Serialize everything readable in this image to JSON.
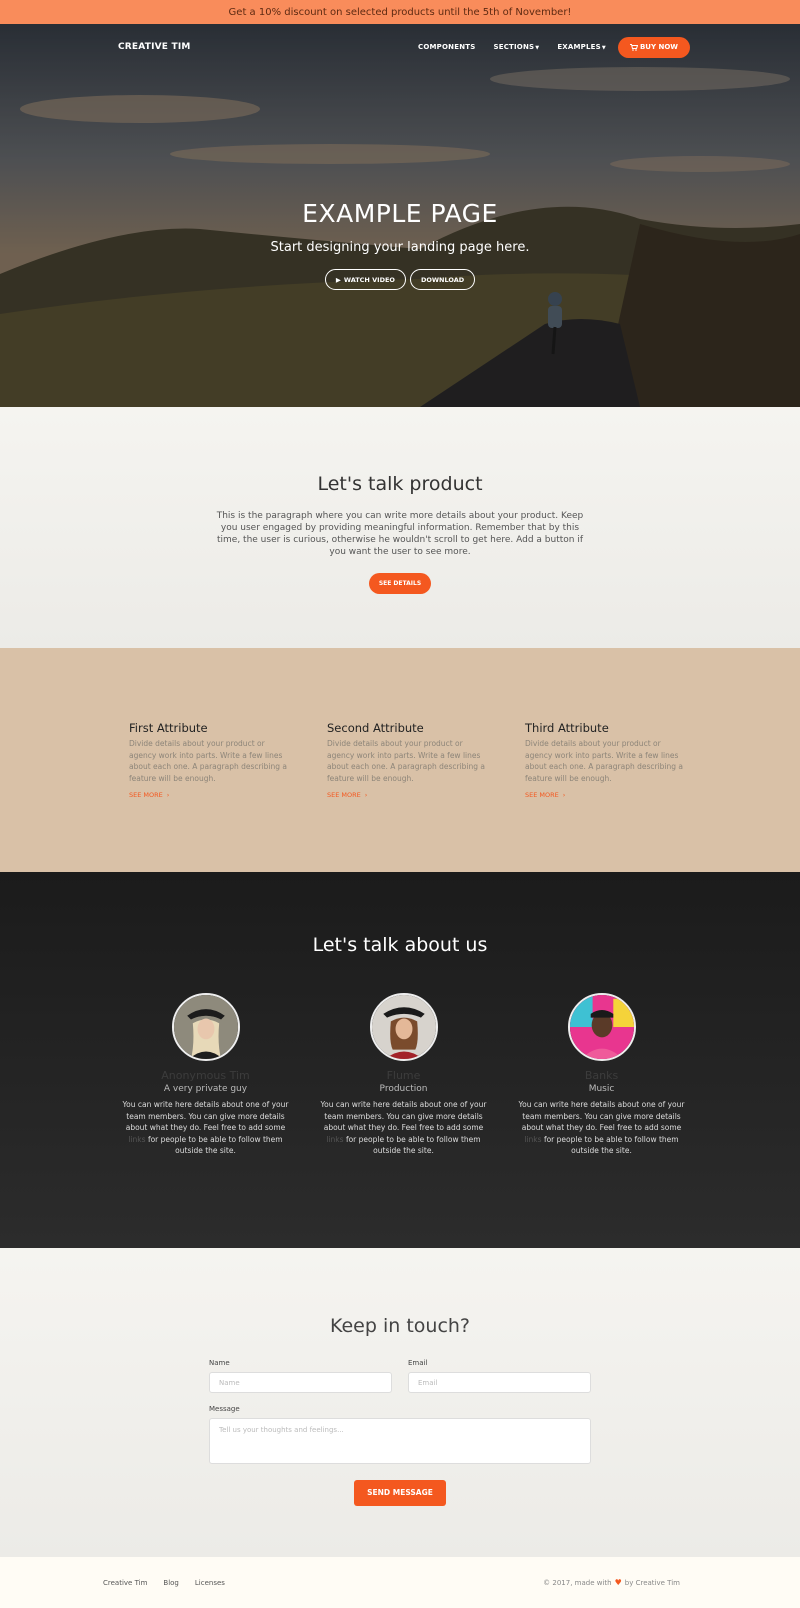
{
  "promo": {
    "text": "Get a 10% discount on selected products until the 5th of November!"
  },
  "nav": {
    "brand": "CREATIVE TIM",
    "links": [
      {
        "label": "COMPONENTS"
      },
      {
        "label": "SECTIONS"
      },
      {
        "label": "EXAMPLES"
      }
    ],
    "buy_label": "BUY NOW"
  },
  "hero": {
    "title": "EXAMPLE PAGE",
    "subtitle": "Start designing your landing page here.",
    "watch_label": "WATCH VIDEO",
    "download_label": "DOWNLOAD"
  },
  "product": {
    "title": "Let's talk product",
    "paragraph": "This is the paragraph where you can write more details about your product. Keep you user engaged by providing meaningful information. Remember that by this time, the user is curious, otherwise he wouldn't scroll to get here. Add a button if you want the user to see more.",
    "button": "SEE DETAILS"
  },
  "attributes": [
    {
      "title": "First Attribute",
      "text": "Divide details about your product or agency work into parts. Write a few lines about each one. A paragraph describing a feature will be enough.",
      "link": "SEE MORE"
    },
    {
      "title": "Second Attribute",
      "text": "Divide details about your product or agency work into parts. Write a few lines about each one. A paragraph describing a feature will be enough.",
      "link": "SEE MORE"
    },
    {
      "title": "Third Attribute",
      "text": "Divide details about your product or agency work into parts. Write a few lines about each one. A paragraph describing a feature will be enough.",
      "link": "SEE MORE"
    }
  ],
  "team": {
    "title": "Let's talk about us",
    "members": [
      {
        "name": "Anonymous Tim",
        "role": "A very private guy",
        "desc_before": "You can write here details about one of your team members. You can give more details about what they do. Feel free to add some",
        "link": "links",
        "desc_after": "for people to be able to follow them outside the site."
      },
      {
        "name": "Flume",
        "role": "Production",
        "desc_before": "You can write here details about one of your team members. You can give more details about what they do. Feel free to add some",
        "link": "links",
        "desc_after": "for people to be able to follow them outside the site."
      },
      {
        "name": "Banks",
        "role": "Music",
        "desc_before": "You can write here details about one of your team members. You can give more details about what they do. Feel free to add some",
        "link": "links",
        "desc_after": "for people to be able to follow them outside the site."
      }
    ]
  },
  "contact": {
    "title": "Keep in touch?",
    "name_label": "Name",
    "name_placeholder": "Name",
    "email_label": "Email",
    "email_placeholder": "Email",
    "message_label": "Message",
    "message_placeholder": "Tell us your thoughts and feelings...",
    "send_label": "SEND MESSAGE"
  },
  "footer": {
    "links": [
      "Creative Tim",
      "Blog",
      "Licenses"
    ],
    "copy_before": "© 2017, made with",
    "copy_after": "by Creative Tim"
  },
  "colors": {
    "accent": "#f4581f",
    "promo_bg": "#f98c5b",
    "attributes_bg": "#d9c1a7",
    "team_bg": "#1b1b1b"
  }
}
